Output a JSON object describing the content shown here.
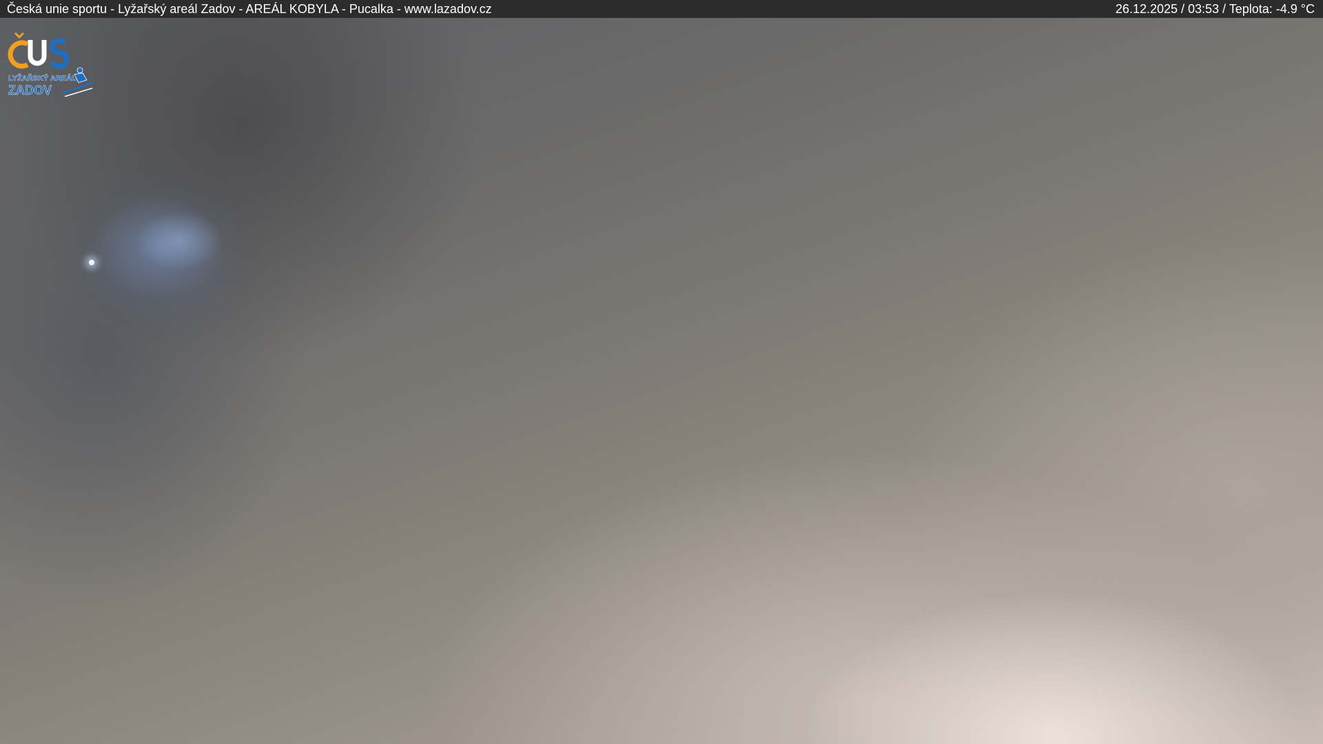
{
  "overlay": {
    "caption": "Česká unie sportu - Lyžařský areál Zadov - AREÁL KOBYLA - Pucalka - www.lazadov.cz",
    "date": "26.12.2025",
    "time": "03:53",
    "temperature_label": "Teplota:",
    "temperature_value": "-4.9 °C",
    "info_line": "26.12.2025 / 03:53 / Teplota: -4.9 °C"
  },
  "logo": {
    "mark": "ČUS",
    "line1": "LYŽAŘSKÝ AREÁL",
    "line2": "ZADOV"
  },
  "colors": {
    "bar_background": "#2c2c2c",
    "bar_text": "#ffffff",
    "logo_orange": "#f0a020",
    "logo_blue": "#1e6fc4"
  }
}
